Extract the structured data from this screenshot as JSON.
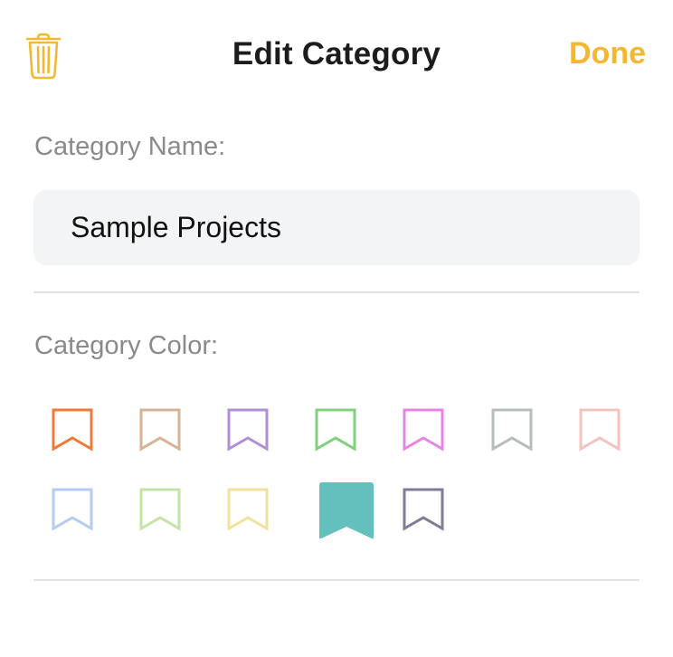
{
  "header": {
    "title": "Edit Category",
    "done_label": "Done",
    "delete_icon": "trash-icon",
    "accent_color": "#f5b731"
  },
  "name_section": {
    "label": "Category Name:",
    "value": "Sample Projects"
  },
  "color_section": {
    "label": "Category Color:",
    "swatches": [
      {
        "color": "#ef7a37",
        "selected": false
      },
      {
        "color": "#d6b394",
        "selected": false
      },
      {
        "color": "#b08fd6",
        "selected": false
      },
      {
        "color": "#7fd17f",
        "selected": false
      },
      {
        "color": "#e884e6",
        "selected": false
      },
      {
        "color": "#b7bcbe",
        "selected": false
      },
      {
        "color": "#f3c3bd",
        "selected": false
      },
      {
        "color": "#b3ccef",
        "selected": false
      },
      {
        "color": "#c3e4a6",
        "selected": false
      },
      {
        "color": "#f0e29c",
        "selected": false
      },
      {
        "color": "#63c0bc",
        "selected": true
      },
      {
        "color": "#807c98",
        "selected": false
      }
    ]
  }
}
